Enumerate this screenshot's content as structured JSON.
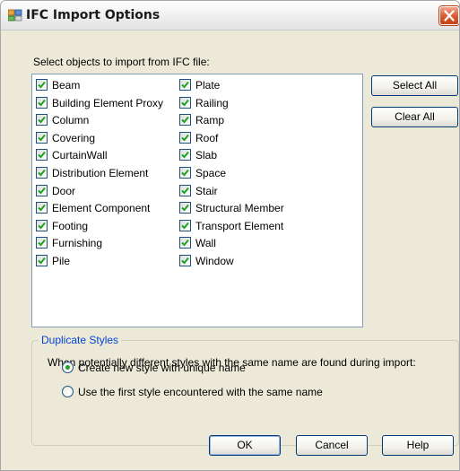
{
  "window": {
    "title": "IFC Import Options",
    "close_icon": "close-icon",
    "app_icon": "ifc-window-icon"
  },
  "objects": {
    "prompt": "Select objects to import from IFC file:",
    "items": [
      {
        "label": "Beam",
        "checked": true
      },
      {
        "label": "Building Element Proxy",
        "checked": true
      },
      {
        "label": "Column",
        "checked": true
      },
      {
        "label": "Covering",
        "checked": true
      },
      {
        "label": "CurtainWall",
        "checked": true
      },
      {
        "label": "Distribution Element",
        "checked": true
      },
      {
        "label": "Door",
        "checked": true
      },
      {
        "label": "Element Component",
        "checked": true
      },
      {
        "label": "Footing",
        "checked": true
      },
      {
        "label": "Furnishing",
        "checked": true
      },
      {
        "label": "Pile",
        "checked": true
      },
      {
        "label": "Plate",
        "checked": true
      },
      {
        "label": "Railing",
        "checked": true
      },
      {
        "label": "Ramp",
        "checked": true
      },
      {
        "label": "Roof",
        "checked": true
      },
      {
        "label": "Slab",
        "checked": true
      },
      {
        "label": "Space",
        "checked": true
      },
      {
        "label": "Stair",
        "checked": true
      },
      {
        "label": "Structural Member",
        "checked": true
      },
      {
        "label": "Transport Element",
        "checked": true
      },
      {
        "label": "Wall",
        "checked": true
      },
      {
        "label": "Window",
        "checked": true
      }
    ]
  },
  "side_buttons": {
    "select_all": "Select All",
    "clear_all": "Clear All"
  },
  "duplicate_styles": {
    "legend": "Duplicate Styles",
    "description": "When potentially different styles with the same name are found during import:",
    "options": [
      {
        "label": "Create new style with unique name",
        "selected": true
      },
      {
        "label": "Use the first style encountered with the same name",
        "selected": false
      }
    ]
  },
  "footer": {
    "ok": "OK",
    "cancel": "Cancel",
    "help": "Help"
  },
  "colors": {
    "dialog_bg": "#ece9d8",
    "check_mark": "#21a121",
    "group_legend": "#0046d5",
    "close_button": "#d9582e"
  }
}
